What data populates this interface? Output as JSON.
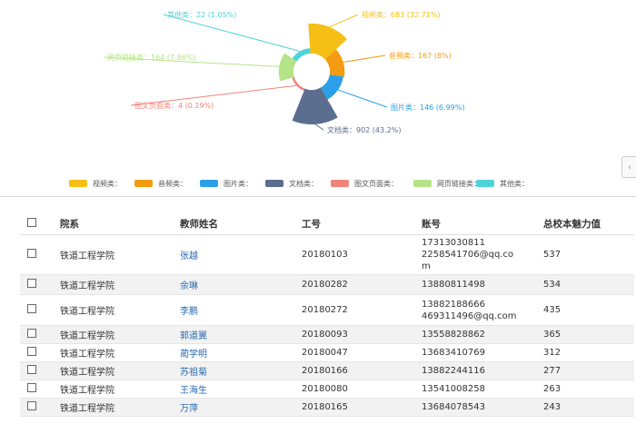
{
  "chart_data": {
    "type": "pie",
    "variant": "nightingale-rose",
    "slices": [
      {
        "name": "视频类",
        "value": 683,
        "percent": "32.71%",
        "label": "视频类：683 (32.71%)",
        "color": "#f5bf16"
      },
      {
        "name": "音频类",
        "value": 167,
        "percent": "8%",
        "label": "音频类：167 (8%)",
        "color": "#f39c12"
      },
      {
        "name": "图片类",
        "value": 146,
        "percent": "6.99%",
        "label": "图片类：146 (6.99%)",
        "color": "#2b9fe8"
      },
      {
        "name": "文档类",
        "value": 902,
        "percent": "43.2%",
        "label": "文档类：902 (43.2%)",
        "color": "#5b6e8f"
      },
      {
        "name": "图文页面类",
        "value": 4,
        "percent": "0.19%",
        "label": "图文页面类：4 (0.19%)",
        "color": "#f2837a"
      },
      {
        "name": "网页链接类",
        "value": 164,
        "percent": "7.86%",
        "label": "网页链接类：164 (7.86%)",
        "color": "#b5e488"
      },
      {
        "name": "其他类",
        "value": 22,
        "percent": "1.05%",
        "label": "其他类：22 (1.05%)",
        "color": "#4fd3d8"
      }
    ],
    "legend": {
      "placement": "bottom",
      "items": [
        "视频类：",
        "音频类：",
        "图片类：",
        "文档类：",
        "图文页面类：",
        "网页链接类：",
        "其他类："
      ]
    }
  },
  "side_toggle": "‹",
  "table": {
    "columns": [
      "院系",
      "教师姓名",
      "工号",
      "账号",
      "总校本魅力值"
    ],
    "rows": [
      {
        "dept": "铁道工程学院",
        "name": "张越",
        "id": "20180103",
        "account": [
          "17313030811",
          "2258541706@qq.co",
          "m"
        ],
        "score": "537"
      },
      {
        "dept": "铁道工程学院",
        "name": "余琳",
        "id": "20180282",
        "account": [
          "13880811498"
        ],
        "score": "534"
      },
      {
        "dept": "铁道工程学院",
        "name": "李鹏",
        "id": "20180272",
        "account": [
          "13882188666",
          "469311496@qq.com"
        ],
        "score": "435"
      },
      {
        "dept": "铁道工程学院",
        "name": "郭道翼",
        "id": "20180093",
        "account": [
          "13558828862"
        ],
        "score": "365"
      },
      {
        "dept": "铁道工程学院",
        "name": "蔺学明",
        "id": "20180047",
        "account": [
          "13683410769"
        ],
        "score": "312"
      },
      {
        "dept": "铁道工程学院",
        "name": "苏祖菊",
        "id": "20180166",
        "account": [
          "13882244116"
        ],
        "score": "277"
      },
      {
        "dept": "铁道工程学院",
        "name": "王海生",
        "id": "20180080",
        "account": [
          "13541008258"
        ],
        "score": "263"
      },
      {
        "dept": "铁道工程学院",
        "name": "万萍",
        "id": "20180165",
        "account": [
          "13684078543"
        ],
        "score": "243"
      }
    ]
  }
}
